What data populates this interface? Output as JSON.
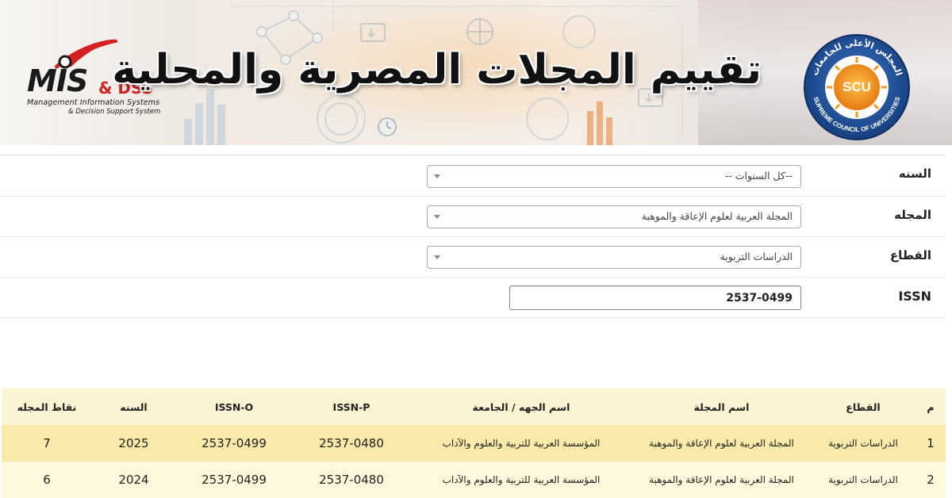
{
  "banner": {
    "title": "تقييم المجلات المصرية والمحلية",
    "left_logo": {
      "main": "MIS",
      "accent": "& DSS",
      "line1": "Management Information Systems",
      "line2": "& Decision Support System"
    },
    "right_logo": {
      "center": "SCU",
      "ring_text_en": "SUPREME COUNCIL OF UNIVERSITIES",
      "ring_text_ar": "المجلس الأعلى للجامعات"
    }
  },
  "filters": {
    "year": {
      "label": "السنه",
      "value": "--كل السنوات --"
    },
    "journal": {
      "label": "المجله",
      "value": "المجلة العربية لعلوم الإعاقة والموهبة"
    },
    "sector": {
      "label": "القطاع",
      "value": "الدراسات التربوية"
    },
    "issn": {
      "label": "ISSN",
      "value": "2537-0499"
    }
  },
  "table": {
    "headers": [
      "م",
      "القطاع",
      "اسم المجلة",
      "اسم الجهه / الجامعة",
      "ISSN-P",
      "ISSN-O",
      "السنه",
      "نقاط المجله"
    ],
    "rows": [
      [
        "1",
        "الدراسات التربوية",
        "المجلة العربية لعلوم الإعاقة والموهبة",
        "المؤسسة العربية للتربية والعلوم والآداب",
        "2537-0480",
        "2537-0499",
        "2025",
        "7"
      ],
      [
        "2",
        "الدراسات التربوية",
        "المجلة العربية لعلوم الإعاقة والموهبة",
        "المؤسسة العربية للتربية والعلوم والآداب",
        "2537-0480",
        "2537-0499",
        "2024",
        "6"
      ]
    ]
  },
  "colors": {
    "header_row": "#fcf3d3",
    "row_highlight": "#f8eaa9",
    "row_alt": "#fff8dd",
    "dss_red": "#d42020",
    "scu_blue": "#1d4f9e",
    "scu_orange": "#f29a1f"
  }
}
